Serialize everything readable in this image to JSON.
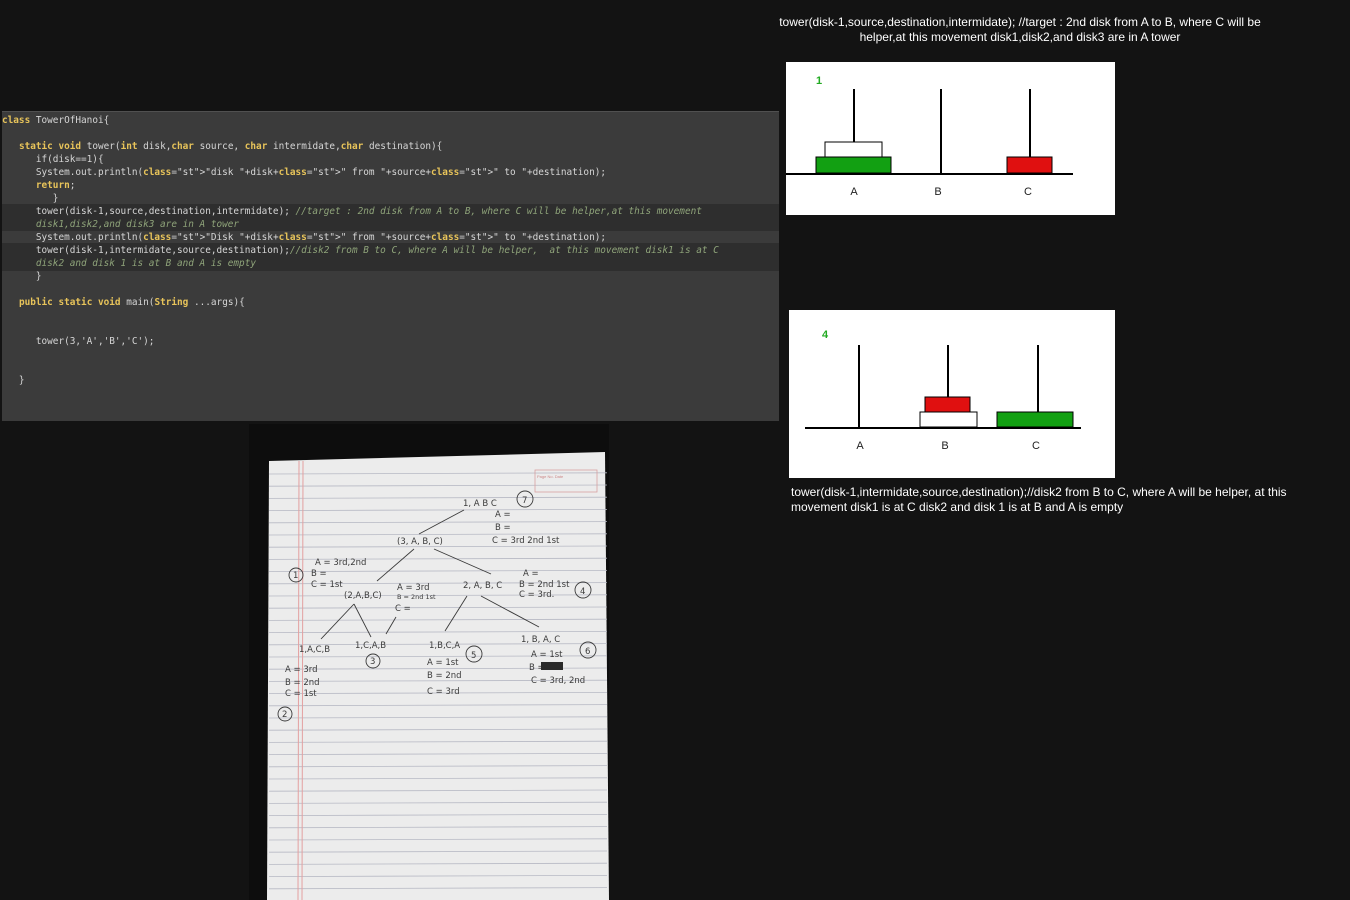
{
  "captions": {
    "top": "tower(disk-1,source,destination,intermidate); //target : 2nd disk from A to B, where C will be helper,at this movement disk1,disk2,and disk3 are in A tower",
    "bottom": "tower(disk-1,intermidate,source,destination);//disk2 from B to C, where A will be helper,  at this movement disk1 is at C disk2 and disk 1 is at B and A is empty"
  },
  "code": {
    "lines": [
      "class TowerOfHanoi{",
      "",
      "   static void tower(int disk,char source, char intermidate,char destination){",
      "      if(disk==1){",
      "      System.out.println(\"disk \"+disk+\" from \"+source+\" to \"+destination);",
      "      return;",
      "         }",
      "      tower(disk-1,source,destination,intermidate); //target : 2nd disk from A to B, where C will be helper,at this movement",
      "      disk1,disk2,and disk3 are in A tower",
      "      System.out.println(\"Disk \"+disk+\" from \"+source+\" to \"+destination);",
      "      tower(disk-1,intermidate,source,destination);//disk2 from B to C, where A will be helper,  at this movement disk1 is at C",
      "      disk2 and disk 1 is at B and A is empty",
      "      }",
      "",
      "   public static void main(String ...args){",
      "",
      "",
      "      tower(3,'A','B','C');",
      "",
      "",
      "   }"
    ]
  },
  "diagram1": {
    "step": "1",
    "pegs": [
      "A",
      "B",
      "C"
    ],
    "colors": {
      "green": "#12a012",
      "red": "#e01010",
      "white": "#ffffff",
      "step": "#22aa22"
    }
  },
  "diagram4": {
    "step": "4",
    "pegs": [
      "A",
      "B",
      "C"
    ]
  },
  "notebook": {
    "header_box": "Page No. Date",
    "nodes": {
      "root": "1, A B C",
      "root_num": "7",
      "root_a": "A =",
      "root_b": "B =",
      "root_c": "C = 3rd 2nd 1st",
      "n3abc": "(3, A, B, C)",
      "left_a": "A = 3rd,2nd",
      "left_num": "1",
      "left_b": "B =",
      "left_c": "C = 1st",
      "n2abc": "(2,A,B,C)",
      "mid_a": "A = 3rd",
      "mid_b": "B = 2nd 1st",
      "mid_c": "C =",
      "n2abc2": "2, A, B, C",
      "right_a": "A =",
      "right_b": "B = 2nd 1st",
      "right_c": "C = 3rd.",
      "right_num": "4",
      "n1acb": "1,A,C,B",
      "n1cab": "1,C,A,B",
      "n1cab_num": "3",
      "ll_a": "A = 3rd",
      "ll_b": "B = 2nd",
      "ll_c": "C = 1st",
      "ll_num": "2",
      "n1bca": "1,B,C,A",
      "n1bca_num": "5",
      "b5_a": "A = 1st",
      "b5_b": "B = 2nd",
      "b5_c": "C = 3rd",
      "n1bac": "1, B, A, C",
      "n1bac_num": "6",
      "b6_a": "A = 1st",
      "b6_b": "B =",
      "b6_c": "C = 3rd, 2nd"
    }
  }
}
